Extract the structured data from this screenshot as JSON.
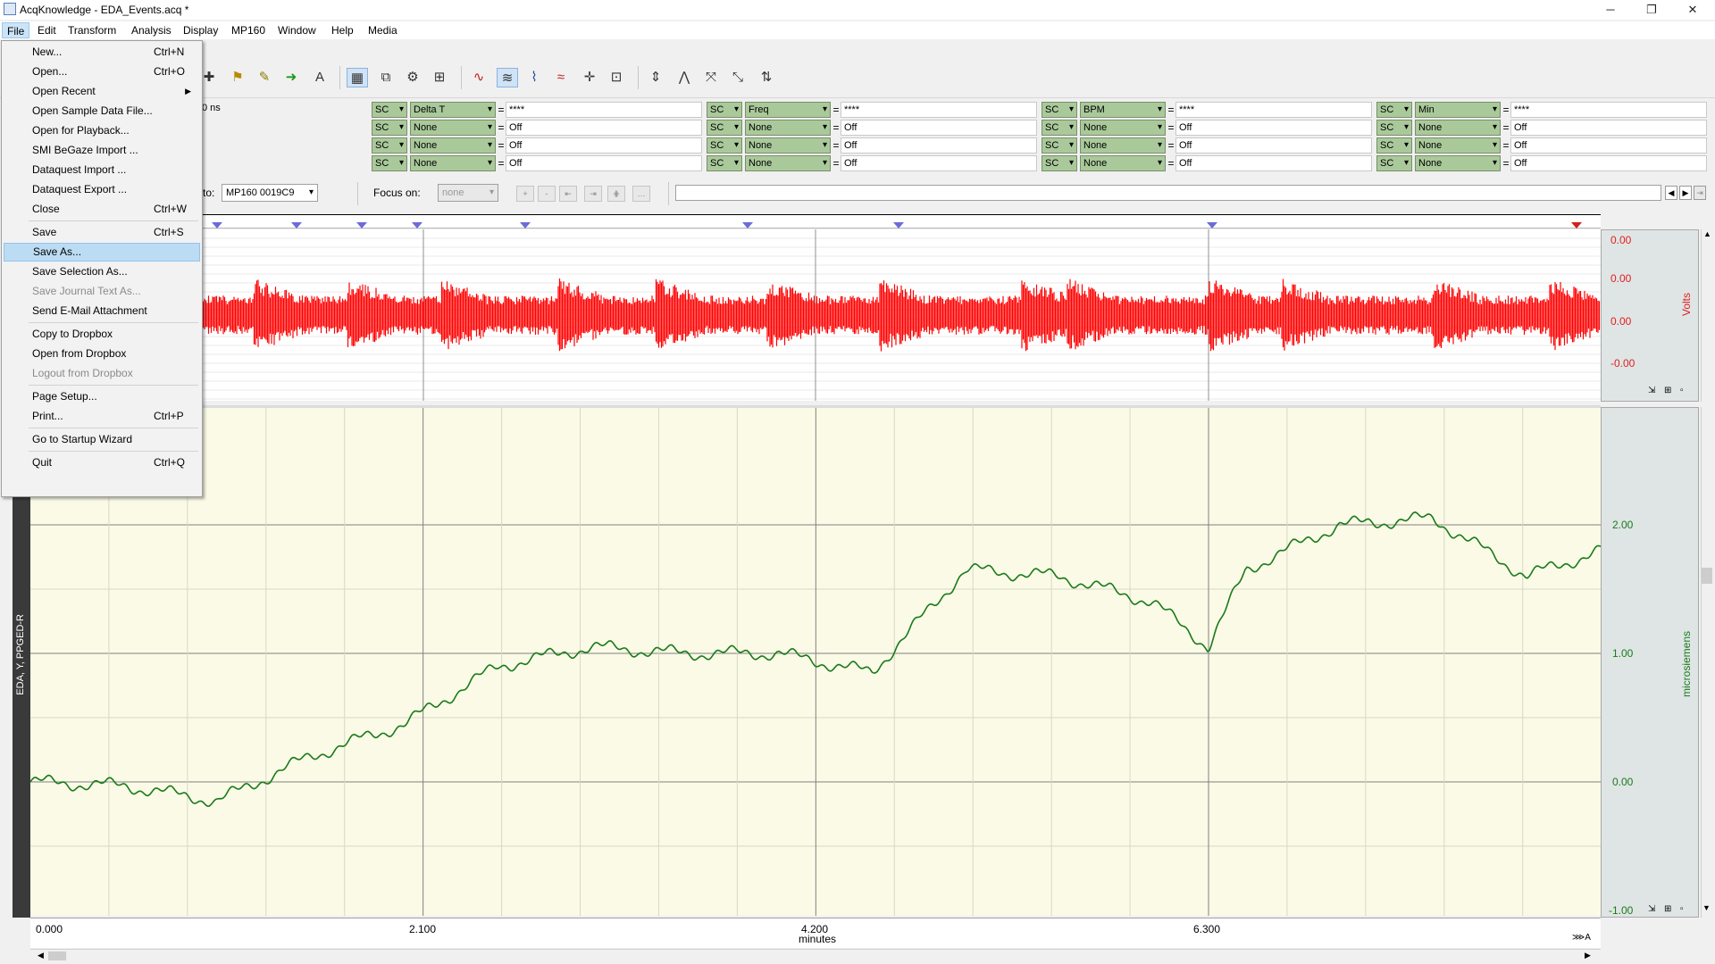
{
  "window": {
    "title": "AcqKnowledge - EDA_Events.acq *"
  },
  "menubar": [
    "File",
    "Edit",
    "Transform",
    "Analysis",
    "Display",
    "MP160",
    "Window",
    "Help",
    "Media"
  ],
  "file_menu": {
    "items": [
      {
        "label": "New...",
        "shortcut": "Ctrl+N"
      },
      {
        "label": "Open...",
        "shortcut": "Ctrl+O"
      },
      {
        "label": "Open Recent",
        "shortcut": ""
      },
      {
        "label": "Open Sample Data File...",
        "shortcut": ""
      },
      {
        "label": "Open for Playback...",
        "shortcut": ""
      },
      {
        "label": "SMI BeGaze Import ...",
        "shortcut": ""
      },
      {
        "label": "Dataquest Import ...",
        "shortcut": ""
      },
      {
        "label": "Dataquest Export ...",
        "shortcut": ""
      },
      {
        "label": "Close",
        "shortcut": "Ctrl+W"
      },
      {
        "label": "Save",
        "shortcut": "Ctrl+S"
      },
      {
        "label": "Save As...",
        "shortcut": ""
      },
      {
        "label": "Save Selection As...",
        "shortcut": ""
      },
      {
        "label": "Save Journal Text As...",
        "shortcut": ""
      },
      {
        "label": "Send E-Mail Attachment",
        "shortcut": ""
      },
      {
        "label": "Copy to Dropbox",
        "shortcut": ""
      },
      {
        "label": "Open from Dropbox",
        "shortcut": ""
      },
      {
        "label": "Logout from Dropbox",
        "shortcut": ""
      },
      {
        "label": "Page Setup...",
        "shortcut": ""
      },
      {
        "label": "Print...",
        "shortcut": "Ctrl+P"
      },
      {
        "label": "Go to Startup Wizard",
        "shortcut": ""
      },
      {
        "label": "Quit",
        "shortcut": "Ctrl+Q"
      }
    ],
    "highlighted": "Save As...",
    "disabled": [
      "Save Journal Text As...",
      "Logout from Dropbox"
    ]
  },
  "measurements": {
    "partial_label": "0 ns",
    "columns": [
      {
        "rows": [
          {
            "ch": "SC",
            "fn": "Delta T",
            "val": "****"
          },
          {
            "ch": "SC",
            "fn": "None",
            "val": "Off"
          },
          {
            "ch": "SC",
            "fn": "None",
            "val": "Off"
          },
          {
            "ch": "SC",
            "fn": "None",
            "val": "Off"
          }
        ]
      },
      {
        "rows": [
          {
            "ch": "SC",
            "fn": "Freq",
            "val": "****"
          },
          {
            "ch": "SC",
            "fn": "None",
            "val": "Off"
          },
          {
            "ch": "SC",
            "fn": "None",
            "val": "Off"
          },
          {
            "ch": "SC",
            "fn": "None",
            "val": "Off"
          }
        ]
      },
      {
        "rows": [
          {
            "ch": "SC",
            "fn": "BPM",
            "val": "****"
          },
          {
            "ch": "SC",
            "fn": "None",
            "val": "Off"
          },
          {
            "ch": "SC",
            "fn": "None",
            "val": "Off"
          },
          {
            "ch": "SC",
            "fn": "None",
            "val": "Off"
          }
        ]
      },
      {
        "rows": [
          {
            "ch": "SC",
            "fn": "Min",
            "val": "****"
          },
          {
            "ch": "SC",
            "fn": "None",
            "val": "Off"
          },
          {
            "ch": "SC",
            "fn": "None",
            "val": "Off"
          },
          {
            "ch": "SC",
            "fn": "None",
            "val": "Off"
          }
        ]
      }
    ]
  },
  "connect": {
    "to_label": "to:",
    "device": "MP160 0019C9",
    "focus_label": "Focus on:",
    "focus_value": "none"
  },
  "channel1": {
    "y_ticks": [
      "0.00",
      "0.00",
      "0.00",
      "-0.00"
    ],
    "unit": "Volts",
    "color": "#ff0000"
  },
  "channel2": {
    "y_ticks": [
      "2.00",
      "1.00",
      "0.00",
      "-1.00"
    ],
    "unit": "microsiemens",
    "label": "EDA, Y, PPGED-R",
    "color": "#1a7a1a"
  },
  "x_axis": {
    "ticks": [
      "0.000",
      "2.100",
      "4.200",
      "6.300"
    ],
    "label": "minutes"
  },
  "chart_data": {
    "type": "line",
    "x": [
      0.0,
      0.5,
      1.0,
      1.5,
      2.0,
      2.5,
      3.0,
      3.5,
      4.0,
      4.5,
      5.0,
      5.5,
      6.0,
      6.3,
      6.5,
      7.0,
      7.5,
      8.0,
      8.4
    ],
    "series": [
      {
        "values": [
          0.0,
          -0.03,
          -0.15,
          0.2,
          0.45,
          0.9,
          1.05,
          1.0,
          1.0,
          0.85,
          1.65,
          1.6,
          1.4,
          1.05,
          1.65,
          2.0,
          2.05,
          1.6,
          1.8
        ]
      }
    ],
    "xlabel": "minutes",
    "ylabel": "microsiemens",
    "xlim": [
      0,
      8.4
    ],
    "ylim": [
      -1.0,
      2.5
    ]
  }
}
